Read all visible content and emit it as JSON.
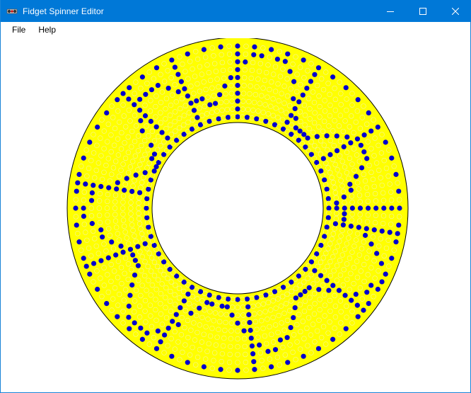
{
  "window": {
    "title": "Fidget Spinner Editor",
    "icon": "fidget-spinner-app-icon",
    "controls": {
      "minimize_icon": "minimize-icon",
      "maximize_icon": "maximize-icon",
      "close_icon": "close-icon"
    }
  },
  "menu": {
    "items": [
      {
        "label": "File"
      },
      {
        "label": "Help"
      }
    ]
  },
  "spinner": {
    "ring_color": "#ffff00",
    "outline_color": "#000000",
    "dot_color": "#ffff00",
    "selected_dot_color": "#0000cc",
    "rings": 10,
    "spokes": 120
  },
  "colors": {
    "titlebar": "#0078d7",
    "titlebar_text": "#ffffff",
    "menubar": "#ffffff"
  }
}
